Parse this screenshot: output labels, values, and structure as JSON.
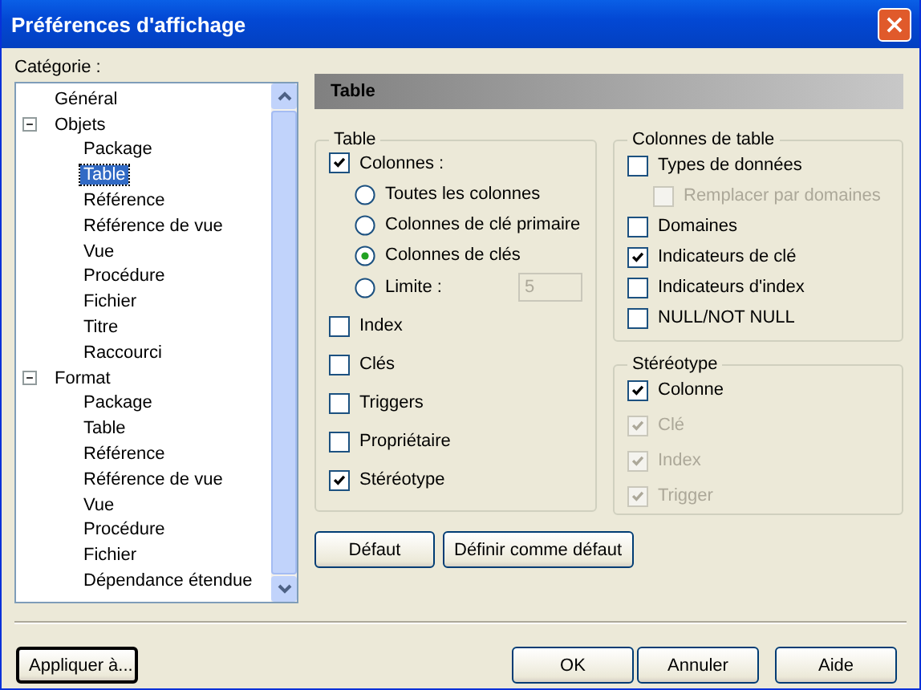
{
  "window": {
    "title": "Préférences d'affichage"
  },
  "category_label": "Catégorie :",
  "tree": [
    {
      "label": "Général",
      "selected": false
    },
    {
      "label": "Objets",
      "selected": false,
      "expanded": true,
      "children": [
        {
          "label": "Package",
          "selected": false
        },
        {
          "label": "Table",
          "selected": true
        },
        {
          "label": "Référence",
          "selected": false
        },
        {
          "label": "Référence de vue",
          "selected": false
        },
        {
          "label": "Vue",
          "selected": false
        },
        {
          "label": "Procédure",
          "selected": false
        },
        {
          "label": "Fichier",
          "selected": false
        },
        {
          "label": "Titre",
          "selected": false
        },
        {
          "label": "Raccourci",
          "selected": false
        }
      ]
    },
    {
      "label": "Format",
      "selected": false,
      "expanded": true,
      "children": [
        {
          "label": "Package",
          "selected": false
        },
        {
          "label": "Table",
          "selected": false
        },
        {
          "label": "Référence",
          "selected": false
        },
        {
          "label": "Référence de vue",
          "selected": false
        },
        {
          "label": "Vue",
          "selected": false
        },
        {
          "label": "Procédure",
          "selected": false
        },
        {
          "label": "Fichier",
          "selected": false
        },
        {
          "label": "Dépendance étendue",
          "selected": false
        }
      ]
    }
  ],
  "panel_title": "Table",
  "table_group": {
    "title": "Table",
    "columns_option": {
      "label": "Colonnes :",
      "checked": true,
      "disabled": false
    },
    "radios": [
      {
        "label": "Toutes les colonnes",
        "selected": false
      },
      {
        "label": "Colonnes de clé primaire",
        "selected": false
      },
      {
        "label": "Colonnes de clés",
        "selected": true
      },
      {
        "label": "Limite :",
        "selected": false
      }
    ],
    "limit_field": {
      "value": "5",
      "disabled": true
    },
    "options": [
      {
        "label": "Index",
        "checked": false,
        "disabled": false
      },
      {
        "label": "Clés",
        "checked": false,
        "disabled": false
      },
      {
        "label": "Triggers",
        "checked": false,
        "disabled": false
      },
      {
        "label": "Propriétaire",
        "checked": false,
        "disabled": false
      },
      {
        "label": "Stéréotype",
        "checked": true,
        "disabled": false
      }
    ]
  },
  "column_group": {
    "title": "Colonnes de table",
    "options": [
      {
        "label": "Types de données",
        "checked": false,
        "disabled": false,
        "indented": false
      },
      {
        "label": "Remplacer par domaines",
        "checked": false,
        "disabled": true,
        "indented": true
      },
      {
        "label": "Domaines",
        "checked": false,
        "disabled": false,
        "indented": false
      },
      {
        "label": "Indicateurs de clé",
        "checked": true,
        "disabled": false,
        "indented": false
      },
      {
        "label": "Indicateurs d'index",
        "checked": false,
        "disabled": false,
        "indented": false
      },
      {
        "label": "NULL/NOT NULL",
        "checked": false,
        "disabled": false,
        "indented": false
      }
    ]
  },
  "stereotype_group": {
    "title": "Stéréotype",
    "options": [
      {
        "label": "Colonne",
        "checked": true,
        "disabled": false
      },
      {
        "label": "Clé",
        "checked": true,
        "disabled": true
      },
      {
        "label": "Index",
        "checked": true,
        "disabled": true
      },
      {
        "label": "Trigger",
        "checked": true,
        "disabled": true
      }
    ]
  },
  "panel_buttons": [
    "Défaut",
    "Définir comme défaut"
  ],
  "apply_button": "Appliquer à...",
  "buttons": [
    "OK",
    "Annuler",
    "Aide"
  ]
}
